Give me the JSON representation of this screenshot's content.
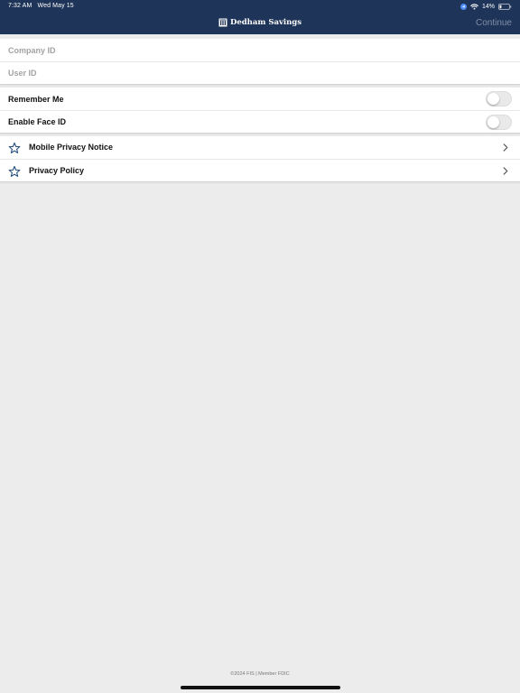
{
  "status_bar": {
    "time": "7:32 AM",
    "date": "Wed May 15",
    "battery": "14%",
    "icons": [
      "location-icon",
      "wifi-icon",
      "battery-icon"
    ]
  },
  "header": {
    "brand_name": "Dedham Savings",
    "brand_icon": "bank-building-icon",
    "continue_label": "Continue",
    "background_color": "#1e3458"
  },
  "login_fields": {
    "company_id_placeholder": "Company ID",
    "user_id_placeholder": "User ID"
  },
  "settings": {
    "remember_me_label": "Remember Me",
    "remember_me_on": false,
    "face_id_label": "Enable Face ID",
    "face_id_on": false
  },
  "links": [
    {
      "label": "Mobile Privacy Notice",
      "icon": "star-icon"
    },
    {
      "label": "Privacy Policy",
      "icon": "star-icon"
    }
  ],
  "footer": {
    "text": "©2024 FIS | Member FDIC"
  },
  "colors": {
    "accent_star": "#1e4a7a",
    "background": "#ececec"
  }
}
